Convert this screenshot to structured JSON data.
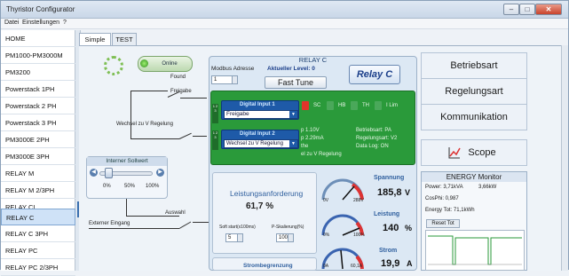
{
  "window": {
    "title": "Thyristor Configurator",
    "min": "–",
    "max": "□",
    "close": "✕"
  },
  "menu": {
    "file": "Datei",
    "settings": "Einstellungen",
    "help": "?"
  },
  "sidebar": {
    "items": [
      {
        "label": "HOME"
      },
      {
        "label": "PM1000-PM3000M"
      },
      {
        "label": "PM3200"
      },
      {
        "label": "Powerstack 1PH"
      },
      {
        "label": "Powerstack 2 PH"
      },
      {
        "label": "Powerstack 3 PH"
      },
      {
        "label": "PM3000E  2PH"
      },
      {
        "label": "PM3000E  3PH"
      },
      {
        "label": "RELAY M"
      },
      {
        "label": "RELAY M 2/3PH"
      },
      {
        "label": "RELAY CL"
      },
      {
        "label": "RELAY C"
      },
      {
        "label": "RELAY C 3PH"
      },
      {
        "label": "RELAY PC"
      },
      {
        "label": "RELAY PC 2/3PH"
      }
    ],
    "selected": "RELAY C"
  },
  "tabs": [
    {
      "label": "Simple"
    },
    {
      "label": "TEST"
    }
  ],
  "diagram": {
    "online_label": "Online",
    "found_label": "Found",
    "freigabe_label": "Freigabe",
    "wechsel_label": "Wechsel zu V Regelung",
    "auswahl_label": "Auswahl",
    "extern_label": "Externer Eingang",
    "sollwert_title": "Interner Sollwert",
    "sollwert_ticks": [
      "0%",
      "50%",
      "100%"
    ]
  },
  "panel": {
    "title": "RELAY C",
    "modbus_label": "Modbus Adresse",
    "modbus_value": "1",
    "level_label": "Aktueller Level: 0",
    "fast_tune": "Fast Tune",
    "logo": "Relay C",
    "digital_input_1": "Digital Input 1",
    "digital_input_1_value": "Freigabe",
    "digital_input_2": "Digital Input 2",
    "digital_input_2_value": "Wechsel zu V Regelung",
    "led_labels": [
      "SC",
      "HB",
      "TH",
      "I Lim"
    ],
    "info_left": [
      "p 1.10V",
      "p 2.29mA",
      "the",
      "el zu V Regelung"
    ],
    "info_right": [
      "Betriebsart: PA",
      "Regelungsart: V2",
      "Data Log: ON"
    ],
    "leistung_label": "Leistungsanforderung",
    "leistung_value": "61,7  %",
    "softstart_label": "Soft start(x100ms)",
    "softstart_value": "5",
    "pskal_label": "P-Skalierung(%)",
    "pskal_value": "100",
    "strom_begrenzung": "Strombegrenzung",
    "spannung_label": "Spannung",
    "spannung_value": "185,8",
    "spannung_unit": "V",
    "spannung_min": "0V",
    "spannung_max": "288V",
    "leistung2_label": "Leistung",
    "leistung2_value": "140",
    "leistung2_unit": "%",
    "leistung2_min": "0%",
    "leistung2_max": "100%",
    "strom_label": "Strom",
    "strom_value": "19,9",
    "strom_unit": "A",
    "strom_min": "0A",
    "strom_max": "60,1A"
  },
  "right": {
    "betriebsart": "Betriebsart",
    "regelungsart": "Regelungsart",
    "kommunikation": "Kommunikation",
    "scope": "Scope"
  },
  "energy": {
    "title": "ENERGY Monitor",
    "power": "Power: 3,71kVA",
    "power2": "3,66kW",
    "cosphi": "CosPhi: 0,987",
    "energy_tot": "Energy Tot: 71,1kWh",
    "reset": "Reset Tot"
  },
  "colors": {
    "accent": "#2a9a3a",
    "brand_blue": "#1e5aa8",
    "selected": "#cfe2f7",
    "led_red": "#e0342a"
  }
}
